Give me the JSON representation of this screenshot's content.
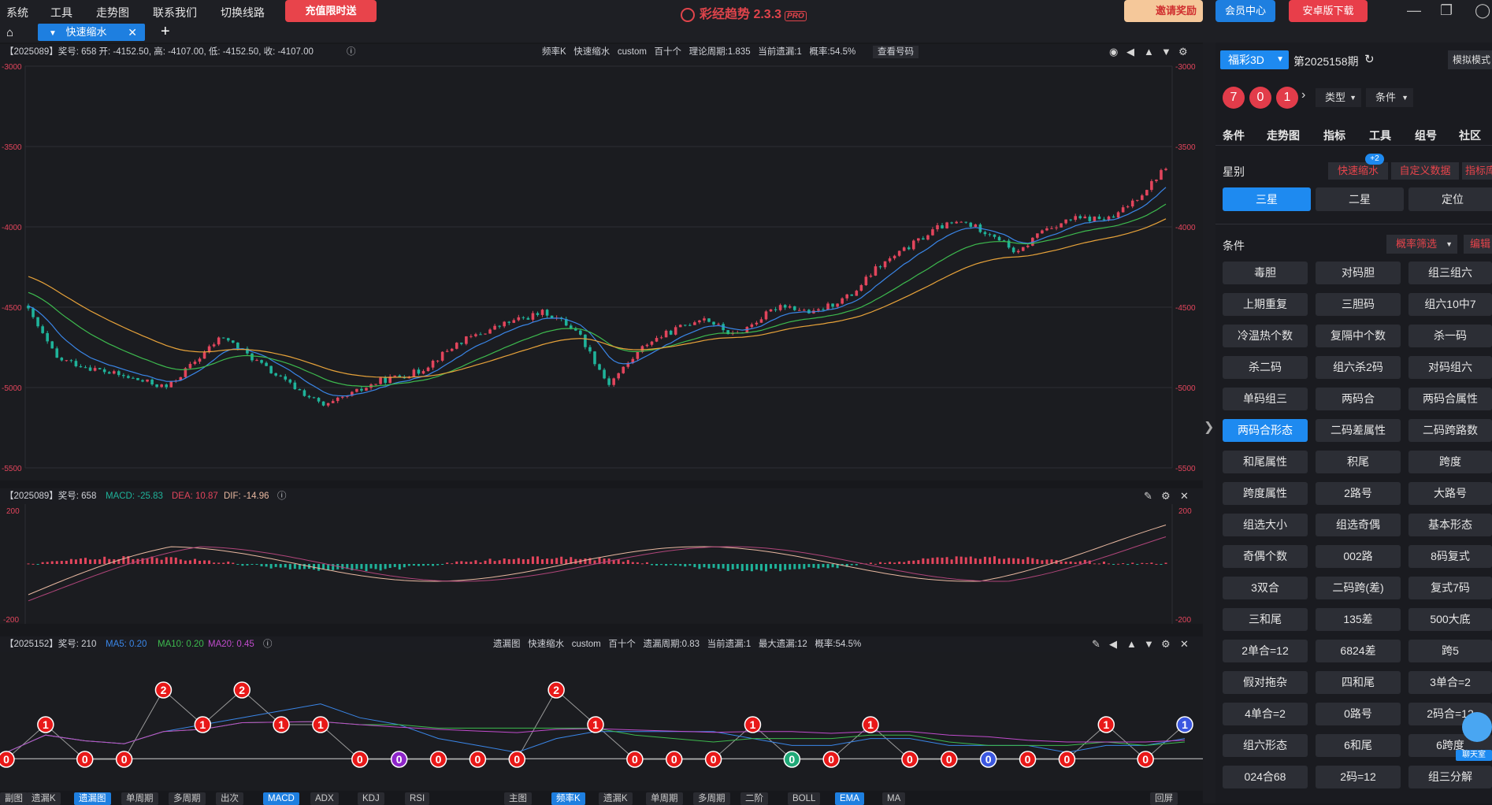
{
  "menu": {
    "items": [
      "系统",
      "工具",
      "走势图",
      "联系我们",
      "切换线路"
    ],
    "promo": "充值限时送"
  },
  "app": {
    "title": "彩经趋势 2.3.3",
    "badge": "PRO"
  },
  "header_buttons": {
    "invite": "邀请奖励",
    "member": "会员中心",
    "android": "安卓版下载"
  },
  "tabs": {
    "active": "快速缩水"
  },
  "kchart": {
    "info": "【2025089】奖号: 658  开: -4152.50, 高: -4107.00, 低: -4152.50, 收: -4107.00",
    "center": [
      "频率K",
      "快速缩水",
      "custom",
      "百十个",
      "理论周期:1.835",
      "当前遗漏:1",
      "概率:54.5%"
    ],
    "check_label": "查看号码",
    "yticks": [
      "-3000",
      "-3500",
      "-4000",
      "-4500",
      "-5000",
      "-5500"
    ]
  },
  "macd": {
    "prefix": "【2025089】奖号: 658",
    "macd_label": "MACD: -25.83",
    "dea_label": "DEA: 10.87",
    "dif_label": "DIF: -14.96",
    "yticks": [
      "200",
      "-200"
    ]
  },
  "omission": {
    "prefix": "【2025152】奖号: 210",
    "ma5": "MA5: 0.20",
    "ma10": "MA10: 0.20",
    "ma20": "MA20: 0.45",
    "center": [
      "遗漏图",
      "快速缩水",
      "custom",
      "百十个",
      "遗漏周期:0.83",
      "当前遗漏:1",
      "最大遗漏:12",
      "概率:54.5%"
    ],
    "values": [
      0,
      1,
      0,
      0,
      2,
      1,
      2,
      1,
      1,
      0,
      0,
      0,
      0,
      0,
      2,
      1,
      0,
      0,
      0,
      1,
      0,
      0,
      1,
      0,
      0,
      0,
      0,
      0,
      1,
      0,
      1
    ]
  },
  "bottom_tabs": {
    "left": [
      "副图",
      "遗漏K",
      "遗漏图",
      "单周期",
      "多周期",
      "出次",
      "MACD",
      "ADX",
      "KDJ",
      "RSI"
    ],
    "left_active": [
      "遗漏图",
      "MACD"
    ],
    "right": [
      "主图",
      "频率K",
      "遗漏K",
      "单周期",
      "多周期",
      "二阶",
      "BOLL",
      "EMA",
      "MA"
    ],
    "right_active": [
      "频率K",
      "EMA"
    ],
    "far_right": "回屏"
  },
  "sidebar": {
    "lottery": "福彩3D",
    "period": "第2025158期",
    "mode": "模拟模式",
    "balls": [
      "7",
      "0",
      "1"
    ],
    "dropdowns": [
      "类型",
      "条件"
    ],
    "nav": [
      "条件",
      "走势图",
      "指标",
      "工具",
      "组号",
      "社区"
    ],
    "star_label": "星别",
    "pills": [
      "快速缩水",
      "自定义数据",
      "指标库"
    ],
    "pill_badge": "+2",
    "stars": [
      "三星",
      "二星",
      "定位"
    ],
    "cond_label": "条件",
    "filter_btn": "概率筛选",
    "edit_label": "编辑",
    "conditions": [
      "毒胆",
      "对码胆",
      "组三组六",
      "上期重复",
      "三胆码",
      "组六10中7",
      "冷温热个数",
      "复隔中个数",
      "杀一码",
      "杀二码",
      "组六杀2码",
      "对码组六",
      "单码组三",
      "两码合",
      "两码合属性",
      "两码合形态",
      "二码差属性",
      "二码跨路数",
      "和尾属性",
      "积尾",
      "跨度",
      "跨度属性",
      "2路号",
      "大路号",
      "组选大小",
      "组选奇偶",
      "基本形态",
      "奇偶个数",
      "002路",
      "8码复式",
      "3双合",
      "二码跨(差)",
      "复式7码",
      "三和尾",
      "135差",
      "500大底",
      "2单合=12",
      "6824差",
      "跨5",
      "假对拖杂",
      "四和尾",
      "3单合=2",
      "4单合=2",
      "0路号",
      "2码合=12",
      "组六形态",
      "6和尾",
      "6跨度",
      "024合68",
      "2码=12",
      "组三分解"
    ],
    "active_condition": "两码合形态",
    "chat": "聊天室"
  },
  "colors": {
    "up": "#e2455c",
    "down": "#1fb39a",
    "ema1": "#3a86e8",
    "ema2": "#3dba4e",
    "ema3": "#e8a33a",
    "accent": "#1e8af0"
  }
}
